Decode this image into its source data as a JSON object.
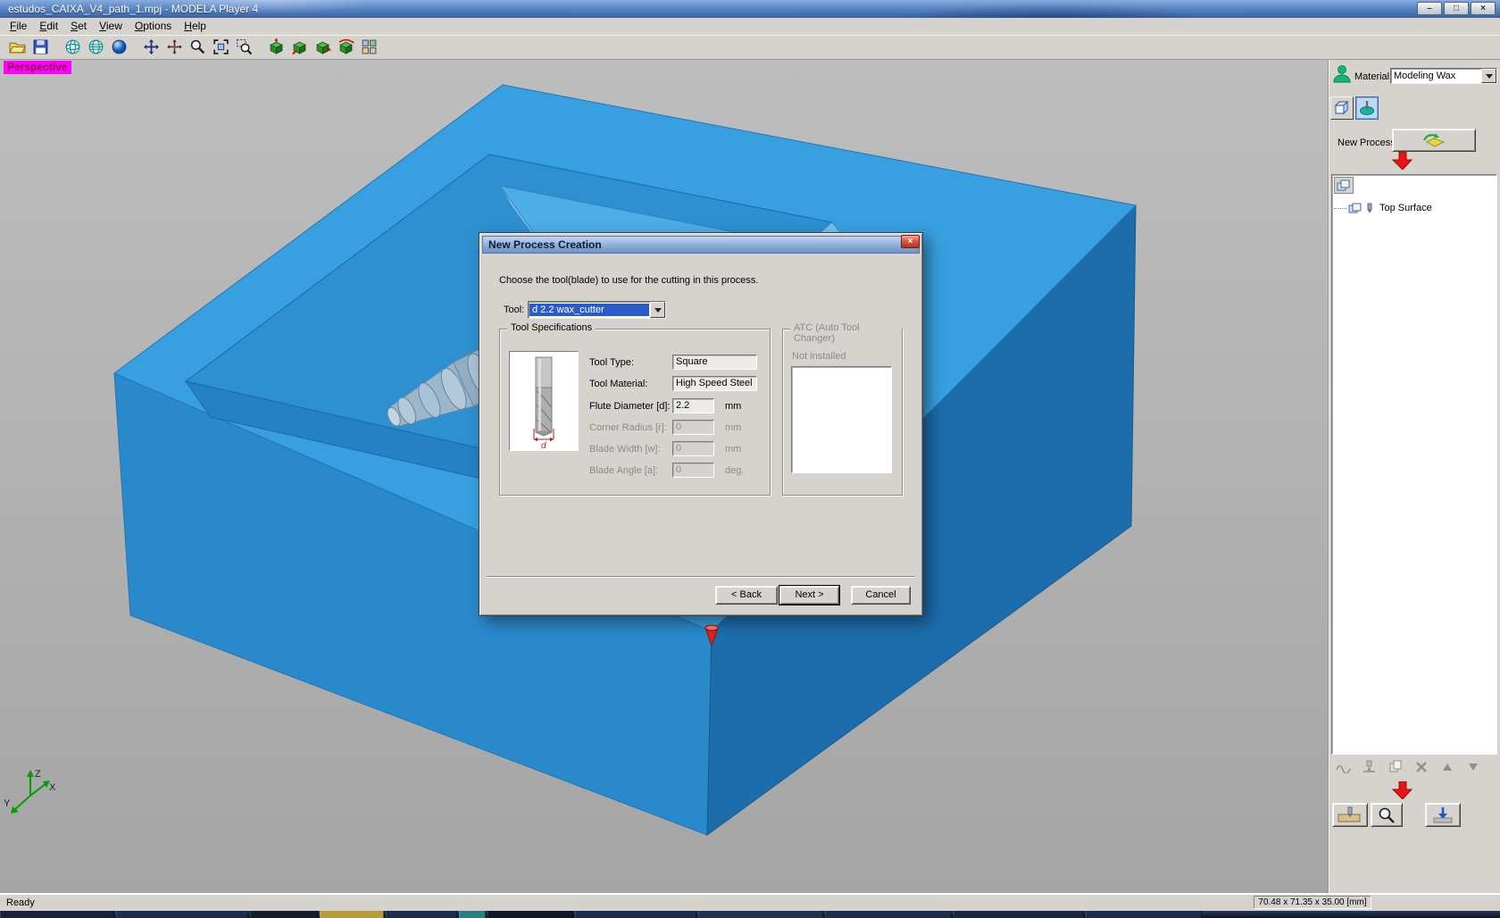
{
  "window": {
    "title": "estudos_CAIXA_V4_path_1.mpj - MODELA Player 4"
  },
  "icons": {
    "minimize": "–",
    "maximize": "□",
    "close": "×"
  },
  "menu": {
    "items": [
      {
        "label": "File"
      },
      {
        "label": "Edit"
      },
      {
        "label": "Set"
      },
      {
        "label": "View"
      },
      {
        "label": "Options"
      },
      {
        "label": "Help"
      }
    ]
  },
  "viewport": {
    "projection_label": "Perspective",
    "axis_labels": {
      "x": "X",
      "y": "Y",
      "z": "Z"
    }
  },
  "dialog": {
    "title": "New Process Creation",
    "description": "Choose the tool(blade) to use for the cutting in this process.",
    "tool_label": "Tool:",
    "tool_value": "d 2.2 wax_cutter",
    "specs": {
      "group_title": "Tool Specifications",
      "tool_image_label": "d",
      "rows": [
        {
          "label": "Tool Type:",
          "value": "Square",
          "unit": ""
        },
        {
          "label": "Tool Material:",
          "value": "High Speed Steel",
          "unit": ""
        },
        {
          "label": "Flute Diameter [d]:",
          "value": "2.2",
          "unit": "mm"
        },
        {
          "label": "Corner Radius [r]:",
          "value": "0",
          "unit": "mm"
        },
        {
          "label": "Blade Width [w]:",
          "value": "0",
          "unit": "mm"
        },
        {
          "label": "Blade Angle [a]:",
          "value": "0",
          "unit": "deg."
        }
      ]
    },
    "atc": {
      "group_title": "ATC (Auto Tool Changer)",
      "status": "Not installed"
    },
    "buttons": {
      "back": "< Back",
      "next": "Next >",
      "cancel": "Cancel"
    }
  },
  "right_panel": {
    "material_label": "Material",
    "material_value": "Modeling Wax",
    "new_process_label": "New Process",
    "tree": {
      "items": [
        {
          "label": "Top Surface"
        }
      ]
    }
  },
  "status_bar": {
    "ready": "Ready",
    "dimensions": "70.48 x 71.35 x 35.00 [mm]"
  }
}
